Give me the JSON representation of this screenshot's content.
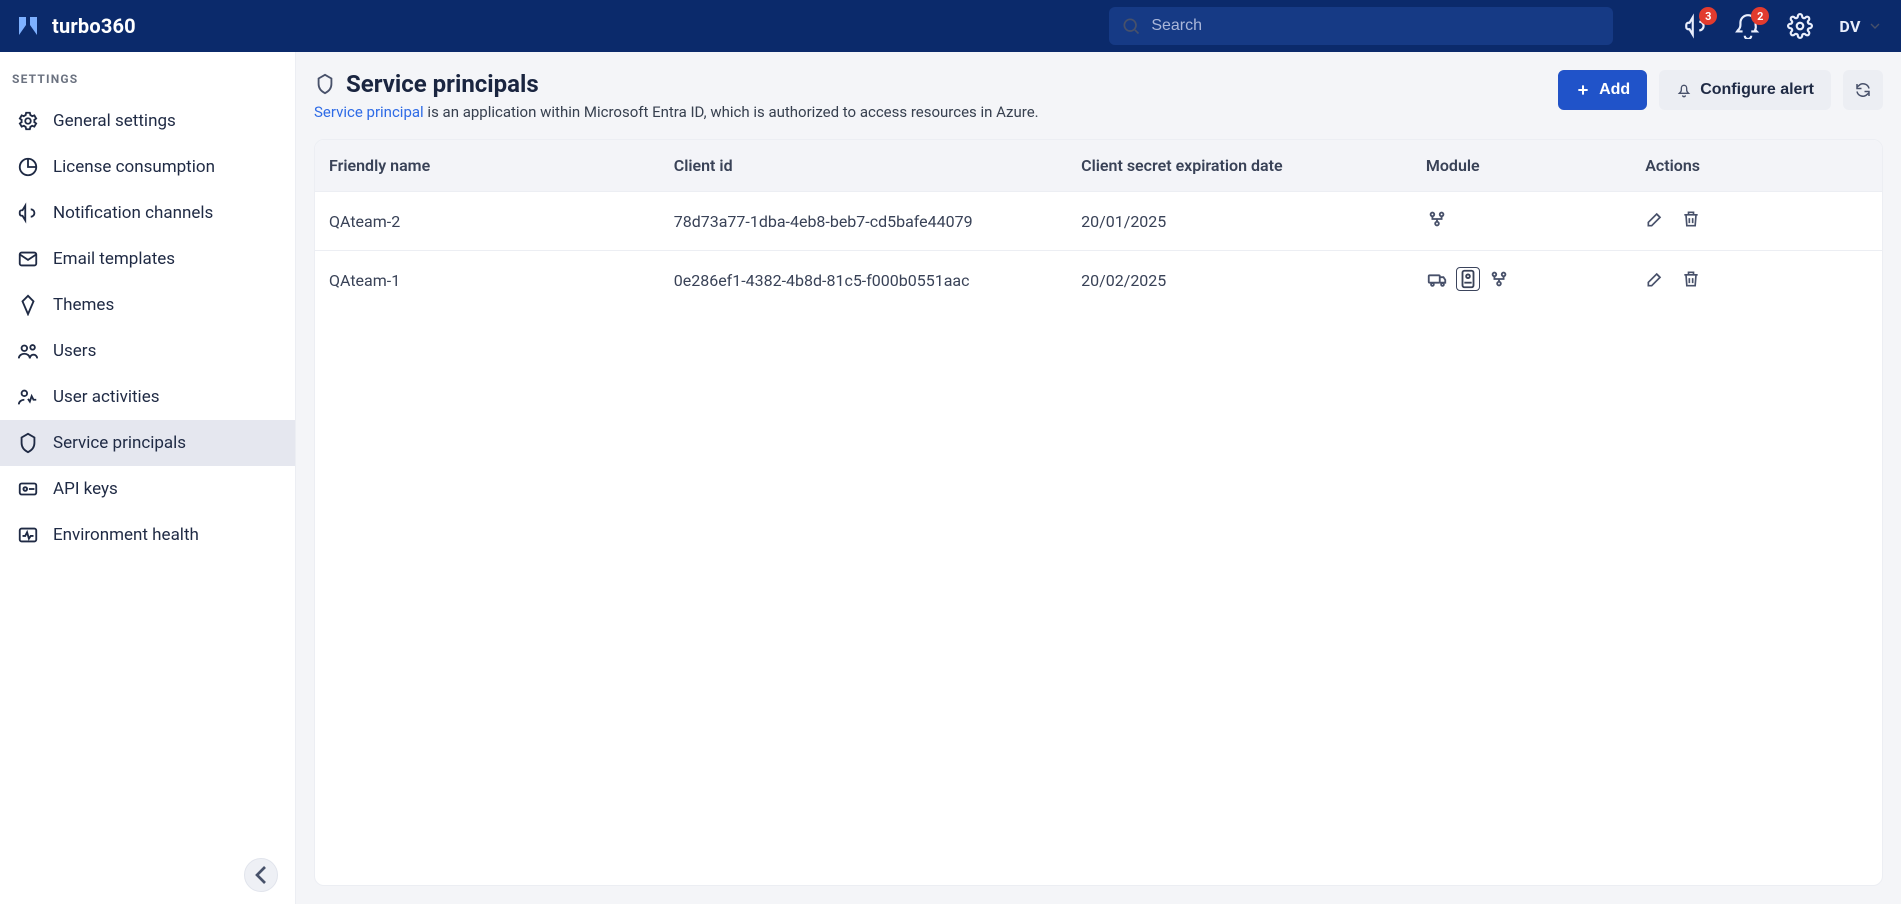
{
  "header": {
    "brand": "turbo360",
    "search_placeholder": "Search",
    "announcement_count": "3",
    "notification_count": "2",
    "user_initials": "DV"
  },
  "sidebar": {
    "heading": "SETTINGS",
    "items": [
      {
        "key": "general-settings",
        "label": "General settings",
        "icon": "gear",
        "active": false
      },
      {
        "key": "license-consumption",
        "label": "License consumption",
        "icon": "pie",
        "active": false
      },
      {
        "key": "notification-channels",
        "label": "Notification channels",
        "icon": "megaphone",
        "active": false
      },
      {
        "key": "email-templates",
        "label": "Email templates",
        "icon": "mail",
        "active": false
      },
      {
        "key": "themes",
        "label": "Themes",
        "icon": "diamond",
        "active": false
      },
      {
        "key": "users",
        "label": "Users",
        "icon": "users",
        "active": false
      },
      {
        "key": "user-activities",
        "label": "User activities",
        "icon": "user-activity",
        "active": false
      },
      {
        "key": "service-principals",
        "label": "Service principals",
        "icon": "shield",
        "active": true
      },
      {
        "key": "api-keys",
        "label": "API keys",
        "icon": "key",
        "active": false
      },
      {
        "key": "environment-health",
        "label": "Environment health",
        "icon": "heartbeat",
        "active": false
      }
    ]
  },
  "page": {
    "title": "Service principals",
    "subtitle_link": "Service principal",
    "subtitle_rest": " is an application within Microsoft Entra ID, which is authorized to access resources in Azure.",
    "add_label": "Add",
    "configure_alert_label": "Configure alert"
  },
  "table": {
    "headers": [
      "Friendly name",
      "Client id",
      "Client secret expiration date",
      "Module",
      "Actions"
    ],
    "rows": [
      {
        "name": "QAteam-2",
        "client_id": "78d73a77-1dba-4eb8-beb7-cd5bafe44079",
        "expiration": "20/01/2025",
        "modules": [
          "org"
        ]
      },
      {
        "name": "QAteam-1",
        "client_id": "0e286ef1-4382-4b8d-81c5-f000b0551aac",
        "expiration": "20/02/2025",
        "modules": [
          "delivery",
          "doc",
          "org"
        ]
      }
    ]
  },
  "colors": {
    "primary": "#2053c9",
    "header": "#0b2a6b",
    "danger": "#e23b2e"
  }
}
